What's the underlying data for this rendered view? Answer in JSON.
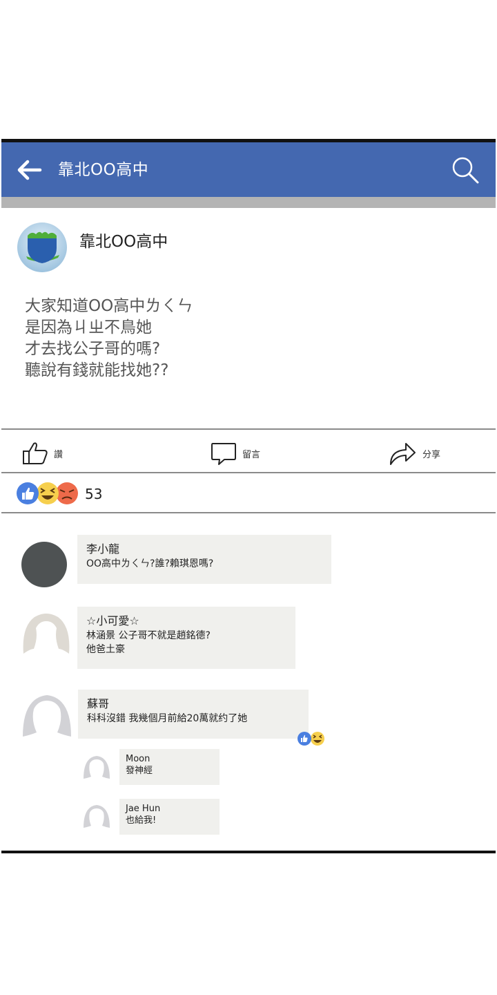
{
  "header": {
    "title": "靠北OO高中"
  },
  "post": {
    "author": "靠北OO高中",
    "lines": [
      "大家知道OO高中ㄌㄑㄣ",
      "是因為ㄐㄓ不鳥她",
      "才去找公子哥的嗎?",
      "聽說有錢就能找她??"
    ]
  },
  "actions": {
    "like": "讚",
    "comment": "留言",
    "share": "分享"
  },
  "reactions": {
    "count": "53",
    "icons": [
      "like-icon",
      "haha-icon",
      "angry-icon"
    ]
  },
  "comments": [
    {
      "name": "李小龍",
      "lines": [
        "OO高中ㄌㄑㄣ?誰?賴琪恩嗎?"
      ]
    },
    {
      "name": "☆小可愛☆",
      "lines": [
        "林涵景 公子哥不就是趙銘德?",
        "他爸土豪"
      ]
    },
    {
      "name": "蘇哥",
      "lines": [
        "科科沒錯 我幾個月前給20萬就约了她"
      ],
      "reactions": [
        "like-icon",
        "haha-icon"
      ]
    }
  ],
  "replies": [
    {
      "name": "Moon",
      "text": "發神經"
    },
    {
      "name": "Jae Hun",
      "text": "也給我!"
    }
  ],
  "colors": {
    "brand": "#4468b0",
    "bubble": "#f0f0ed"
  }
}
